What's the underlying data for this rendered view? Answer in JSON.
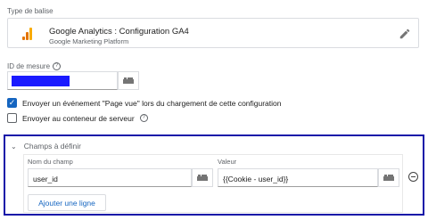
{
  "tag_type": {
    "label": "Type de balise",
    "title": "Google Analytics : Configuration GA4",
    "subtitle": "Google Marketing Platform"
  },
  "measure": {
    "label": "ID de mesure",
    "help": "?"
  },
  "options": {
    "pageview_label": "Envoyer un événement \"Page vue\" lors du chargement de cette configuration",
    "pageview_checked": true,
    "server_label": "Envoyer au conteneur de serveur",
    "server_checked": false,
    "help": "?"
  },
  "fields": {
    "header": "Champs à définir",
    "name_label": "Nom du champ",
    "value_label": "Valeur",
    "rows": [
      {
        "name": "user_id",
        "value": "{{Cookie - user_id}}"
      }
    ],
    "add_button": "Ajouter une ligne"
  },
  "colors": {
    "accent": "#1565c0",
    "highlight_border": "#1414a8",
    "redaction": "#1a1aff"
  }
}
